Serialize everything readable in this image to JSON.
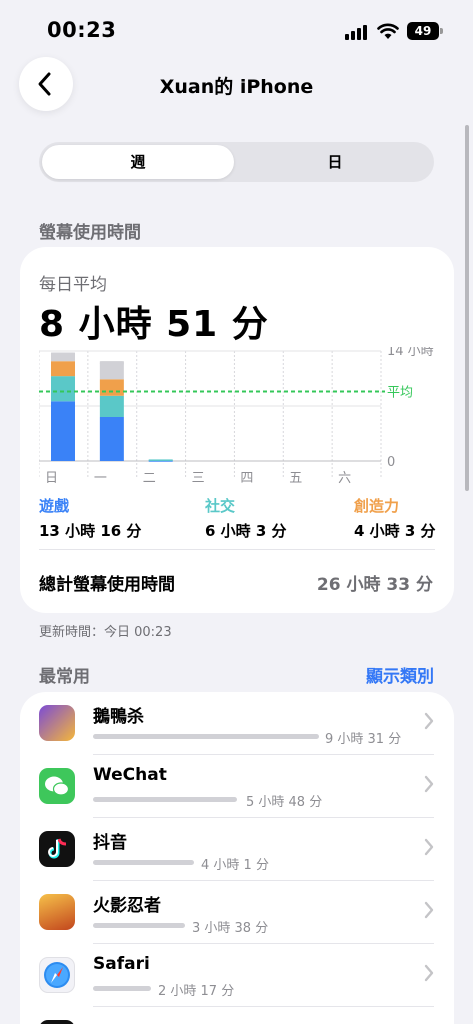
{
  "status": {
    "time": "00:23",
    "battery": "49"
  },
  "nav": {
    "title": "Xuan的 iPhone"
  },
  "segments": {
    "week": "週",
    "day": "日"
  },
  "screen_time": {
    "section_title": "螢幕使用時間",
    "avg_label": "每日平均",
    "avg_value": "8 小時 51 分",
    "categories": [
      {
        "name": "遊戲",
        "value": "13 小時 16 分",
        "color": "#3a82f7"
      },
      {
        "name": "社交",
        "value": "6 小時 3 分",
        "color": "#5ac8c8"
      },
      {
        "name": "創造力",
        "value": "4 小時 3 分",
        "color": "#f0a04b"
      }
    ],
    "total_label": "總計螢幕使用時間",
    "total_value": "26 小時 33 分",
    "updated": "更新時間：今日 00:23"
  },
  "chart_data": {
    "type": "bar",
    "categories": [
      "日",
      "一",
      "二",
      "三",
      "四",
      "五",
      "六"
    ],
    "ylim": [
      0,
      14
    ],
    "ytick_labels": [
      "14 小時",
      "0"
    ],
    "avg_label": "平均",
    "avg_value": 8.85,
    "series": [
      {
        "name": "遊戲",
        "color": "#3a82f7",
        "values": [
          7.6,
          5.6,
          0.1,
          0,
          0,
          0,
          0
        ]
      },
      {
        "name": "社交",
        "color": "#5ac8c8",
        "values": [
          3.2,
          2.7,
          0.1,
          0,
          0,
          0,
          0
        ]
      },
      {
        "name": "創造力",
        "color": "#f0a04b",
        "values": [
          1.9,
          2.1,
          0,
          0,
          0,
          0,
          0
        ]
      },
      {
        "color": "#d1d1d6",
        "values": [
          1.1,
          2.3,
          0,
          0,
          0,
          0,
          0
        ]
      }
    ]
  },
  "most_used": {
    "title": "最常用",
    "show_categories": "顯示類別",
    "apps": [
      {
        "name": "鵝鴨杀",
        "duration": "9 小時 31 分",
        "icon": "goose-duck-app-icon",
        "fraction": 1.0
      },
      {
        "name": "WeChat",
        "duration": "5 小時 48 分",
        "icon": "wechat-app-icon",
        "fraction": 0.61
      },
      {
        "name": "抖音",
        "duration": "4 小時 1 分",
        "icon": "douyin-app-icon",
        "fraction": 0.42
      },
      {
        "name": "火影忍者",
        "duration": "3 小時 38 分",
        "icon": "naruto-app-icon",
        "fraction": 0.38
      },
      {
        "name": "Safari",
        "duration": "2 小時 17 分",
        "icon": "safari-app-icon",
        "fraction": 0.24
      }
    ]
  }
}
